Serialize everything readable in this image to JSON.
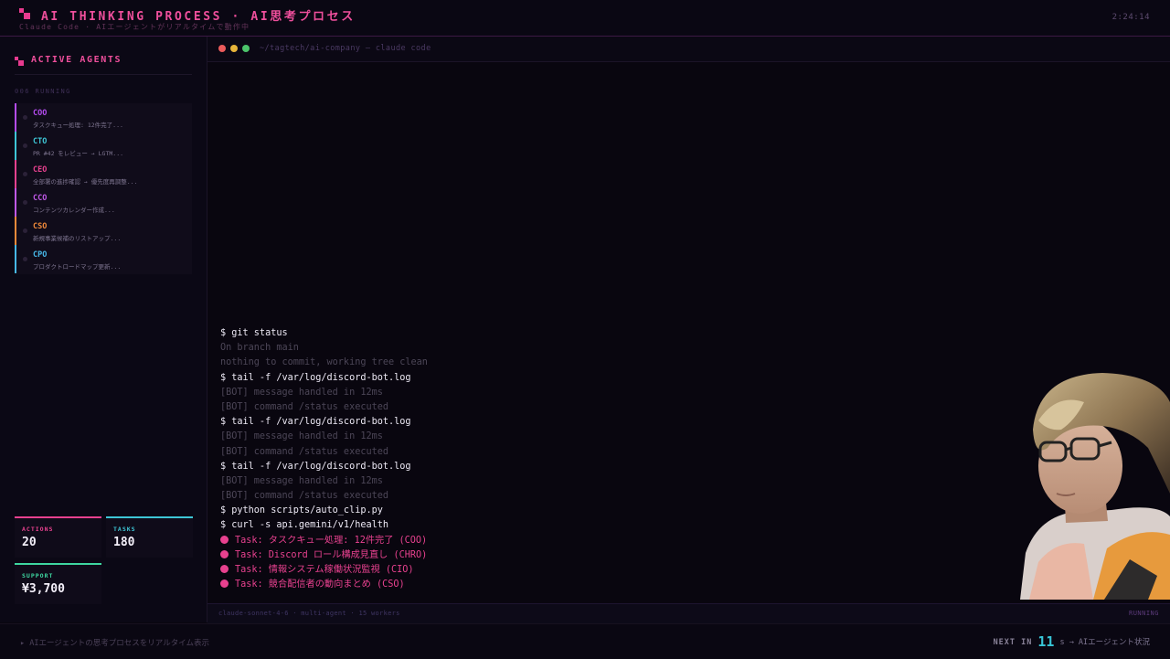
{
  "header": {
    "title": "AI THINKING PROCESS · AI思考プロセス",
    "subtitle": "Claude Code · AIエージェントがリアルタイムで動作中",
    "clock": "2:24:14"
  },
  "sidebar": {
    "title": "ACTIVE AGENTS",
    "running_count": "006 RUNNING",
    "agents": [
      {
        "role": "COO",
        "task": "タスクキュー処理: 12件完了...",
        "color": "#b54cf0"
      },
      {
        "role": "CTO",
        "task": "PR #42 をレビュー → LGTM...",
        "color": "#3ec6d6"
      },
      {
        "role": "CEO",
        "task": "全部署の進捗確認 → 優先度再調整...",
        "color": "#e8418f"
      },
      {
        "role": "CCO",
        "task": "コンテンツカレンダー作成...",
        "color": "#c058e8"
      },
      {
        "role": "CSO",
        "task": "新規事業候補のリストアップ...",
        "color": "#f08a3a"
      },
      {
        "role": "CPO",
        "task": "プロダクトロードマップ更新...",
        "color": "#47b8e8"
      }
    ],
    "stats": [
      {
        "label": "ACTIONS",
        "value": "20",
        "color": "#e8418f"
      },
      {
        "label": "TASKS",
        "value": "180",
        "color": "#3ec6d6"
      },
      {
        "label": "SUPPORT",
        "value": "¥3,700",
        "color": "#3ed6a0"
      }
    ]
  },
  "terminal": {
    "path": "~/tagtech/ai-company — claude code",
    "lines": [
      {
        "type": "cmd",
        "text": "$ git status"
      },
      {
        "type": "out",
        "text": "On branch main"
      },
      {
        "type": "out",
        "text": "nothing to commit, working tree clean"
      },
      {
        "type": "cmd",
        "text": "$ tail -f /var/log/discord-bot.log"
      },
      {
        "type": "out",
        "text": "[BOT] message handled in 12ms"
      },
      {
        "type": "out",
        "text": "[BOT] command /status executed"
      },
      {
        "type": "cmd",
        "text": "$ tail -f /var/log/discord-bot.log"
      },
      {
        "type": "out",
        "text": "[BOT] message handled in 12ms"
      },
      {
        "type": "out",
        "text": "[BOT] command /status executed"
      },
      {
        "type": "cmd",
        "text": "$ tail -f /var/log/discord-bot.log"
      },
      {
        "type": "out",
        "text": "[BOT] message handled in 12ms"
      },
      {
        "type": "out",
        "text": "[BOT] command /status executed"
      },
      {
        "type": "cmd",
        "text": "$ python scripts/auto_clip.py"
      },
      {
        "type": "cmd",
        "text": "$ curl -s api.gemini/v1/health"
      },
      {
        "type": "task",
        "text": "Task: タスクキュー処理: 12件完了 (COO)"
      },
      {
        "type": "task",
        "text": "Task: Discord ロール構成見直し (CHRO)"
      },
      {
        "type": "task",
        "text": "Task: 情報システム稼働状況監視 (CIO)"
      },
      {
        "type": "task",
        "text": "Task: 競合配信者の動向まとめ (CSO)"
      }
    ],
    "status_left": "claude-sonnet-4-6 · multi-agent · 15 workers",
    "status_right": "RUNNING",
    "traffic_lights": [
      "#ec5b5b",
      "#e8b53a",
      "#4cc46a"
    ]
  },
  "footer": {
    "left": "▸ AIエージェントの思考プロセスをリアルタイム表示",
    "next_label": "NEXT IN",
    "next_value": "11",
    "next_suffix": "s → AIエージェント状況"
  }
}
